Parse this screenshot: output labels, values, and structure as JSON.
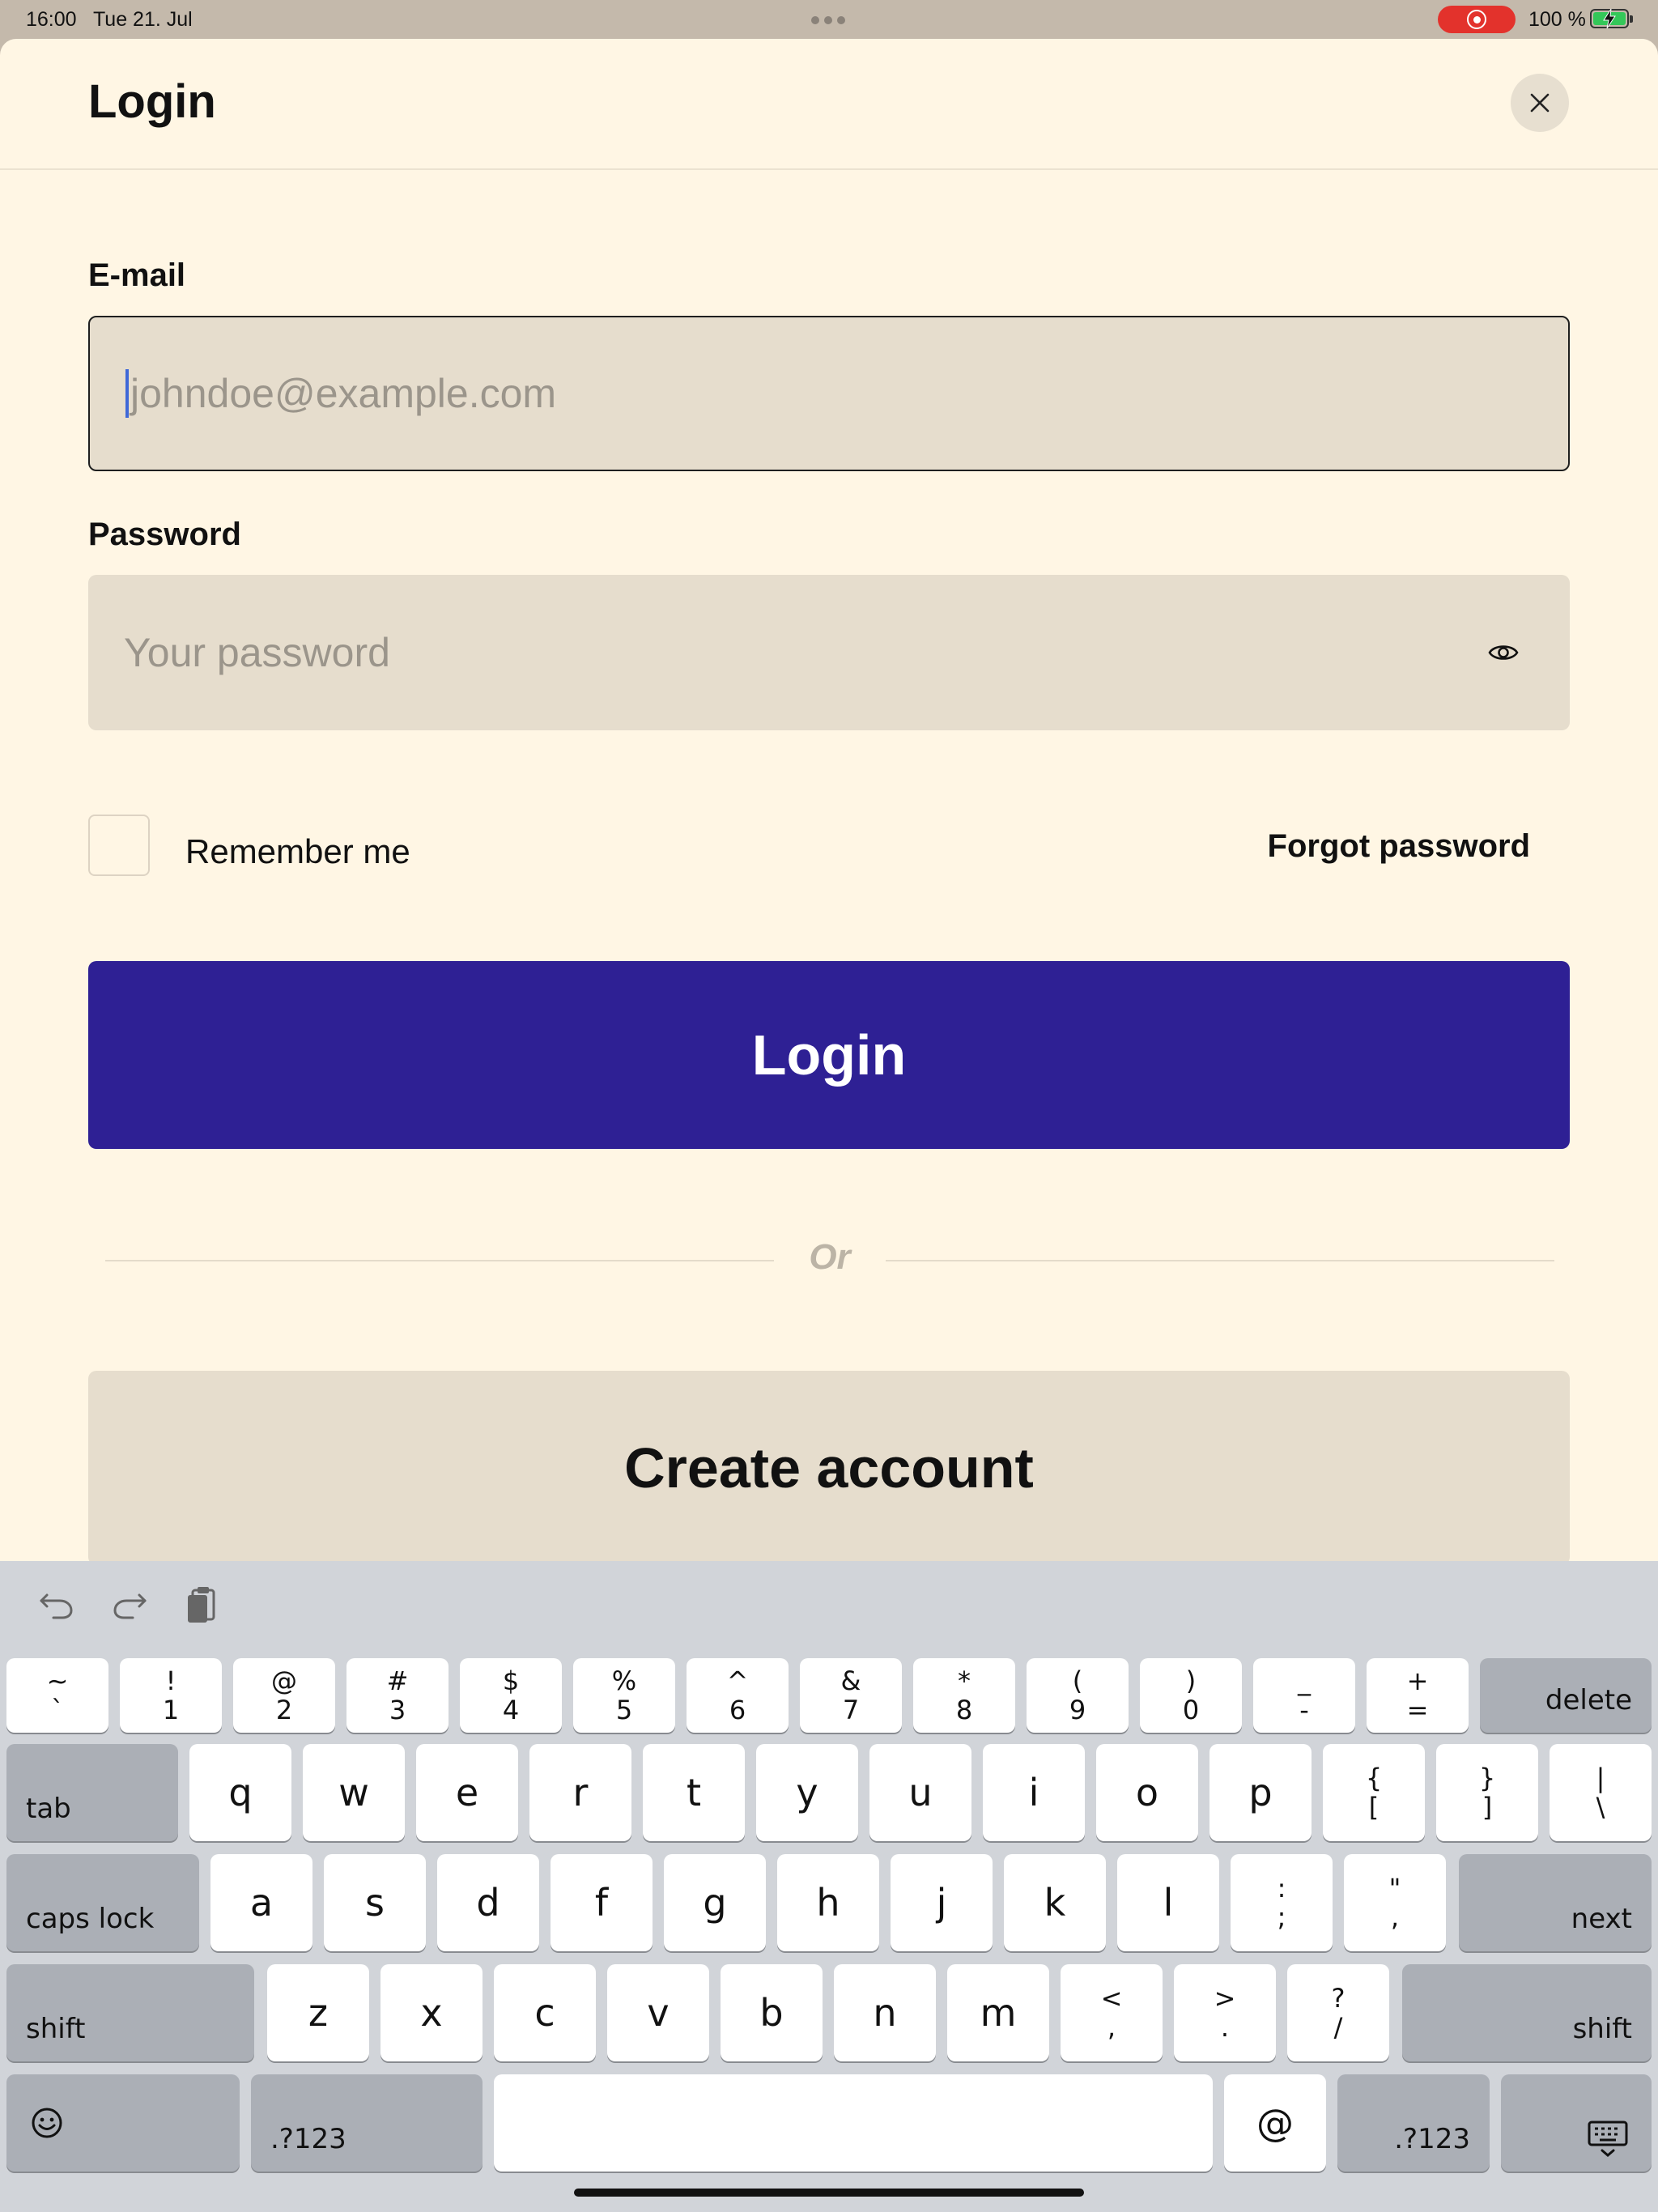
{
  "status_bar": {
    "time": "16:00",
    "date": "Tue 21. Jul",
    "battery": "100 %"
  },
  "header": {
    "title": "Login"
  },
  "form": {
    "email_label": "E-mail",
    "email_value": "",
    "email_placeholder": "johndoe@example.com",
    "password_label": "Password",
    "password_value": "",
    "password_placeholder": "Your password",
    "remember_label": "Remember me",
    "remember_checked": false,
    "forgot_label": "Forgot password",
    "login_label": "Login",
    "or_label": "Or",
    "create_label": "Create account"
  },
  "keyboard": {
    "row1": [
      {
        "top": "~",
        "bottom": "`"
      },
      {
        "top": "!",
        "bottom": "1"
      },
      {
        "top": "@",
        "bottom": "2"
      },
      {
        "top": "#",
        "bottom": "3"
      },
      {
        "top": "$",
        "bottom": "4"
      },
      {
        "top": "%",
        "bottom": "5"
      },
      {
        "top": "^",
        "bottom": "6"
      },
      {
        "top": "&",
        "bottom": "7"
      },
      {
        "top": "*",
        "bottom": "8"
      },
      {
        "top": "(",
        "bottom": "9"
      },
      {
        "top": ")",
        "bottom": "0"
      },
      {
        "top": "_",
        "bottom": "-"
      },
      {
        "top": "+",
        "bottom": "="
      }
    ],
    "delete": "delete",
    "tab": "tab",
    "row2": [
      "q",
      "w",
      "e",
      "r",
      "t",
      "y",
      "u",
      "i",
      "o",
      "p"
    ],
    "row2_sym": [
      {
        "top": "{",
        "bottom": "["
      },
      {
        "top": "}",
        "bottom": "]"
      },
      {
        "top": "|",
        "bottom": "\\"
      }
    ],
    "caps_lock": "caps lock",
    "row3": [
      "a",
      "s",
      "d",
      "f",
      "g",
      "h",
      "j",
      "k",
      "l"
    ],
    "row3_sym": [
      {
        "top": ":",
        "bottom": ";"
      },
      {
        "top": "\"",
        "bottom": ","
      }
    ],
    "next": "next",
    "shift": "shift",
    "row4": [
      "z",
      "x",
      "c",
      "v",
      "b",
      "n",
      "m"
    ],
    "row4_sym": [
      {
        "top": "<",
        "bottom": ","
      },
      {
        "top": ">",
        "bottom": "."
      },
      {
        "top": "?",
        "bottom": "/"
      }
    ],
    "numbers": ".?123",
    "at": "@"
  }
}
